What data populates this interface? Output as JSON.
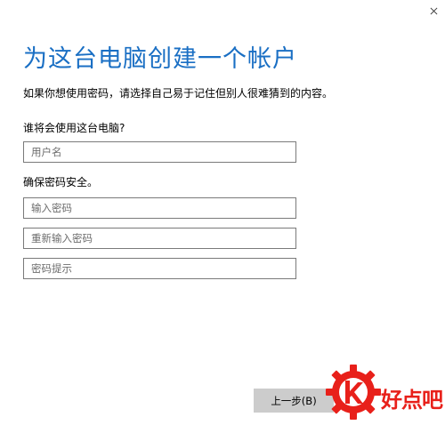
{
  "window": {
    "close_glyph": "×"
  },
  "header": {
    "title": "为这台电脑创建一个帐户",
    "subtitle": "如果你想使用密码，请选择自己易于记住但别人很难猜到的内容。"
  },
  "user_section": {
    "label": "谁将会使用这台电脑?",
    "username_placeholder": "用户名"
  },
  "password_section": {
    "label": "确保密码安全。",
    "password_placeholder": "输入密码",
    "confirm_placeholder": "重新输入密码",
    "hint_placeholder": "密码提示"
  },
  "footer": {
    "back_label": "上一步(B)"
  },
  "watermark": {
    "text": "好点吧",
    "color": "#e8201a"
  },
  "colors": {
    "title": "#1a6fc4",
    "button_bg": "#cccccc",
    "field_border": "#7a7a7a"
  }
}
